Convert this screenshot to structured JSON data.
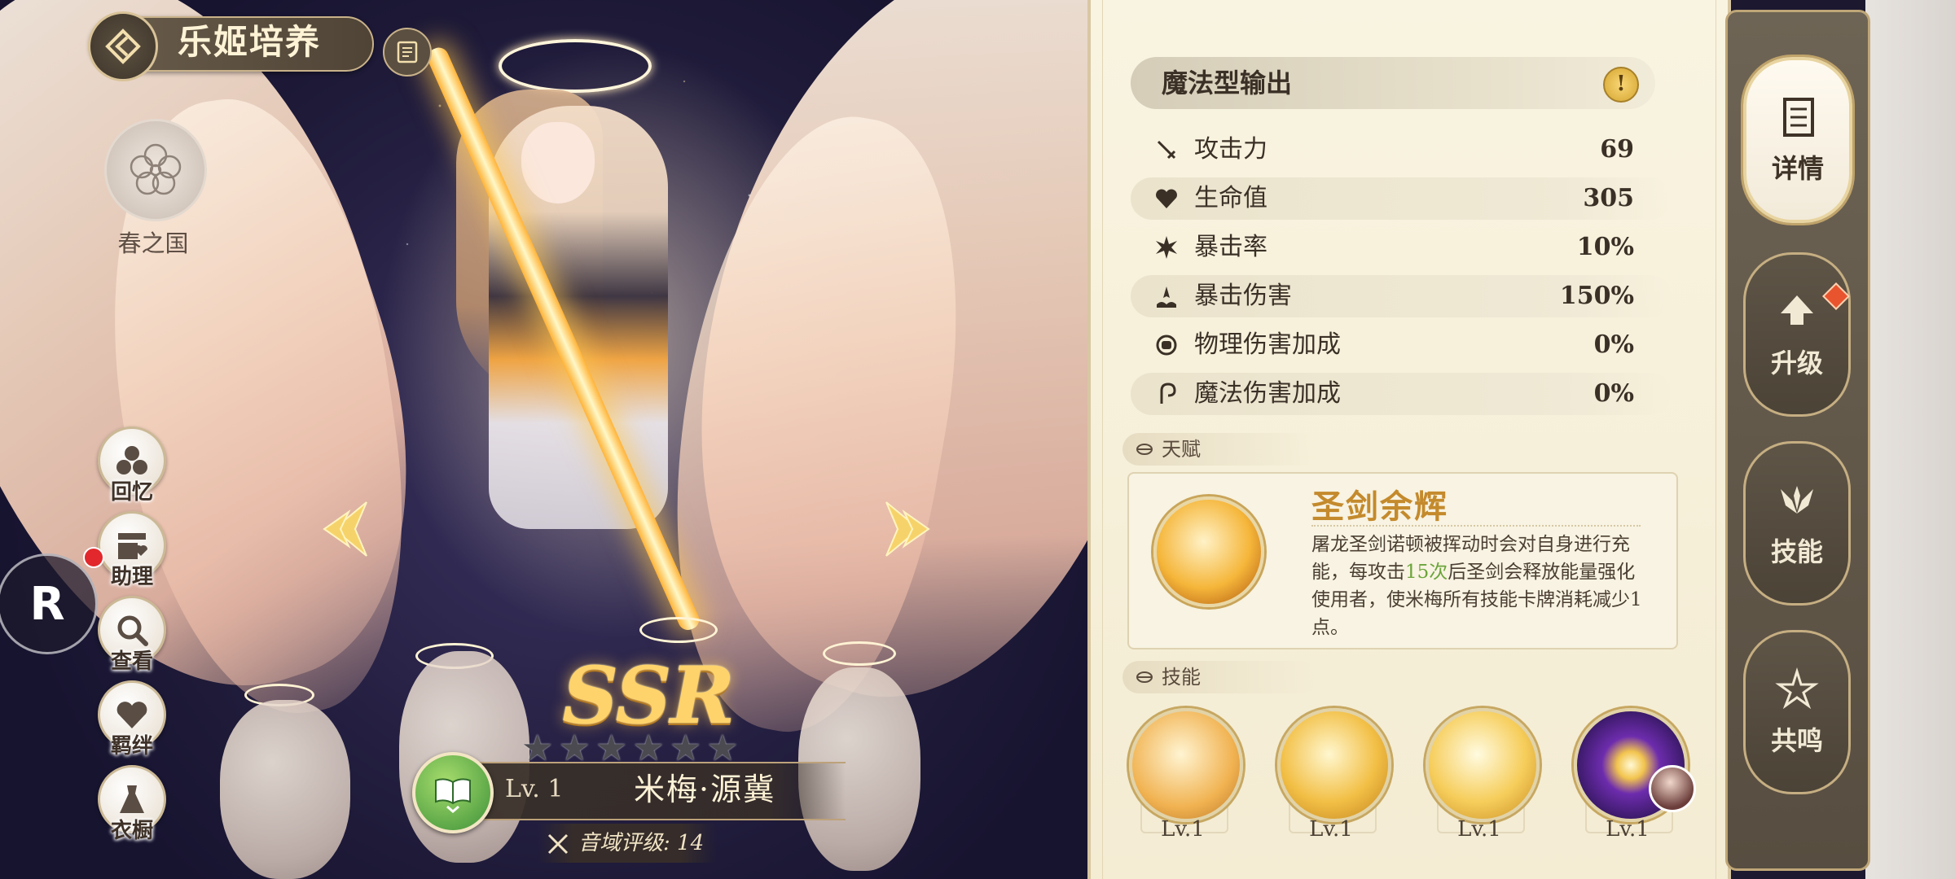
{
  "header": {
    "title": "乐姬培养",
    "region": "春之国"
  },
  "side_menu": [
    {
      "key": "memory",
      "label": "回忆"
    },
    {
      "key": "assistant",
      "label": "助理"
    },
    {
      "key": "view",
      "label": "查看"
    },
    {
      "key": "bond",
      "label": "羁绊"
    },
    {
      "key": "wardrobe",
      "label": "衣橱"
    }
  ],
  "r_badge": "R",
  "character": {
    "rarity": "SSR",
    "stars_total": 6,
    "level": "Lv. 1",
    "name": "米梅·源冀",
    "rating": "音域评级: 14"
  },
  "stats_panel": {
    "type": "魔法型输出",
    "info_icon": "!",
    "stats": [
      {
        "icon": "sword-icon",
        "label": "攻击力",
        "value": "69"
      },
      {
        "icon": "heart-icon",
        "label": "生命值",
        "value": "305"
      },
      {
        "icon": "burst-icon",
        "label": "暴击率",
        "value": "10%"
      },
      {
        "icon": "wave-icon",
        "label": "暴击伤害",
        "value": "150%"
      },
      {
        "icon": "fist-icon",
        "label": "物理伤害加成",
        "value": "0%"
      },
      {
        "icon": "wand-icon",
        "label": "魔法伤害加成",
        "value": "0%"
      }
    ]
  },
  "talent": {
    "section_label": "天赋",
    "name": "圣剑余辉",
    "desc_part1": "屠龙圣剑诺顿被挥动时会对自身进行充能，每攻击",
    "desc_highlight": "15次",
    "desc_part2": "后圣剑会释放能量强化使用者，使米梅所有技能卡牌消耗减少1点。"
  },
  "skills": {
    "section_label": "技能",
    "items": [
      {
        "level": "Lv.1"
      },
      {
        "level": "Lv.1"
      },
      {
        "level": "Lv.1"
      },
      {
        "level": "Lv.1"
      }
    ]
  },
  "tabs": [
    {
      "key": "details",
      "label": "详情",
      "active": true
    },
    {
      "key": "upgrade",
      "label": "升级",
      "active": false
    },
    {
      "key": "skills",
      "label": "技能",
      "active": false
    },
    {
      "key": "resonance",
      "label": "共鸣",
      "active": false
    }
  ],
  "colors": {
    "accent_gold": "#c48a2c",
    "highlight_green": "#6aa43a",
    "notify_red": "#e2282c"
  }
}
